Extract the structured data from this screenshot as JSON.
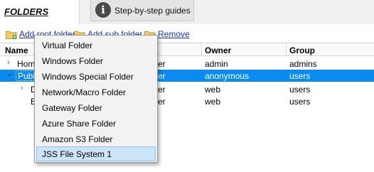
{
  "tabs": {
    "folders": "FOLDERS",
    "guides": "Step-by-step guides",
    "guides_icon_glyph": "i"
  },
  "toolbar": {
    "add_root": "Add root folder",
    "add_sub": "Add sub folder",
    "remove": "Remove"
  },
  "grid": {
    "columns": [
      "Name",
      "",
      "Owner",
      "Group"
    ],
    "rows": [
      {
        "name": "Home",
        "type": "er",
        "owner": "admin",
        "group": "admins",
        "arrow": "›"
      },
      {
        "name": "Publi",
        "type": "er",
        "owner": "anonymous",
        "group": "users",
        "arrow": "⌄"
      },
      {
        "name": "D",
        "type": "er",
        "owner": "web",
        "group": "users",
        "arrow": "›"
      },
      {
        "name": "E",
        "type": "er",
        "owner": "web",
        "group": "users",
        "arrow": ""
      }
    ]
  },
  "menu": {
    "items": [
      "Virtual Folder",
      "Windows Folder",
      "Windows Special Folder",
      "Network/Macro Folder",
      "Gateway Folder",
      "Azure Share Folder",
      "Amazon S3 Folder",
      "JSS File System 1"
    ],
    "hovered_index": 7
  },
  "colors": {
    "selection": "#0a8bf0",
    "link": "#1a35b8",
    "menu_hover": "#cce4f7"
  }
}
